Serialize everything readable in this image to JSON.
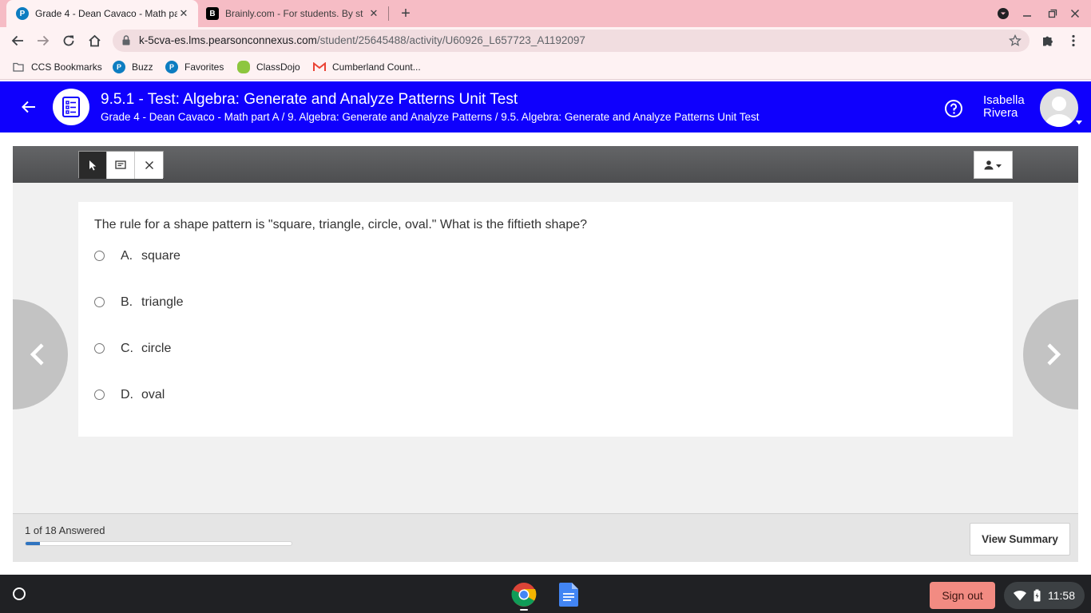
{
  "browser": {
    "tabs": [
      {
        "title": "Grade 4 - Dean Cavaco - Math pa",
        "favicon": "P",
        "favicon_color": "#0d7dc1",
        "active": true
      },
      {
        "title": "Brainly.com - For students. By st",
        "favicon": "B",
        "favicon_color": "#000000",
        "active": false
      }
    ],
    "url_domain": "k-5cva-es.lms.pearsonconnexus.com",
    "url_path": "/student/25645488/activity/U60926_L657723_A1192097",
    "bookmarks": [
      {
        "label": "CCS Bookmarks",
        "icon": "folder-icon"
      },
      {
        "label": "Buzz",
        "icon": "pearson-icon"
      },
      {
        "label": "Favorites",
        "icon": "pearson-icon"
      },
      {
        "label": "ClassDojo",
        "icon": "classdojo-icon"
      },
      {
        "label": "Cumberland Count...",
        "icon": "gmail-icon"
      }
    ],
    "frame_color": "#f6bcc5",
    "toolbar_color": "#fef2f3"
  },
  "header": {
    "title": "9.5.1 - Test: Algebra: Generate and Analyze Patterns Unit Test",
    "breadcrumb": "Grade 4 - Dean Cavaco - Math part A / 9. Algebra: Generate and Analyze Patterns / 9.5. Algebra: Generate and Analyze Patterns Unit Test",
    "user_first": "Isabella",
    "user_last": "Rivera",
    "background": "#0f00fd"
  },
  "question": {
    "text": "The rule for a shape pattern is \"square, triangle, circle, oval.\" What is the fiftieth shape?",
    "choices": [
      {
        "letter": "A.",
        "text": "square"
      },
      {
        "letter": "B.",
        "text": "triangle"
      },
      {
        "letter": "C.",
        "text": "circle"
      },
      {
        "letter": "D.",
        "text": "oval"
      }
    ]
  },
  "status": {
    "answered_text": "1 of 18 Answered",
    "answered": 1,
    "total": 18,
    "progress_color": "#2f74c0",
    "summary_label": "View Summary"
  },
  "shelf": {
    "signout_label": "Sign out",
    "time": "11:58"
  }
}
